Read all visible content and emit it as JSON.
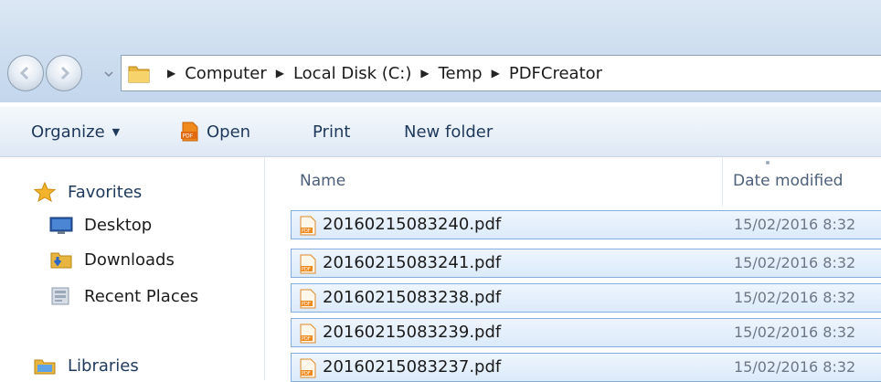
{
  "address": {
    "crumbs": [
      "Computer",
      "Local Disk (C:)",
      "Temp",
      "PDFCreator"
    ]
  },
  "toolbar": {
    "organize_label": "Organize",
    "open_label": "Open",
    "print_label": "Print",
    "new_folder_label": "New folder"
  },
  "nav": {
    "favorites": "Favorites",
    "desktop": "Desktop",
    "downloads": "Downloads",
    "recent_places": "Recent Places",
    "libraries": "Libraries"
  },
  "columns": {
    "name": "Name",
    "date_modified": "Date modified"
  },
  "files": [
    {
      "name": "20160215083240.pdf",
      "date": "15/02/2016 8:32"
    },
    {
      "name": "20160215083241.pdf",
      "date": "15/02/2016 8:32"
    },
    {
      "name": "20160215083238.pdf",
      "date": "15/02/2016 8:32"
    },
    {
      "name": "20160215083239.pdf",
      "date": "15/02/2016 8:32"
    },
    {
      "name": "20160215083237.pdf",
      "date": "15/02/2016 8:32"
    }
  ],
  "icons": {
    "back": "back-arrow-icon",
    "forward": "forward-arrow-icon",
    "folder": "folder-icon",
    "pdf": "pdf-file-icon",
    "star": "star-icon"
  },
  "colors": {
    "selection_fill": "#dbeafa",
    "selection_border": "#84acdd",
    "toolbar_text": "#1e395b"
  }
}
